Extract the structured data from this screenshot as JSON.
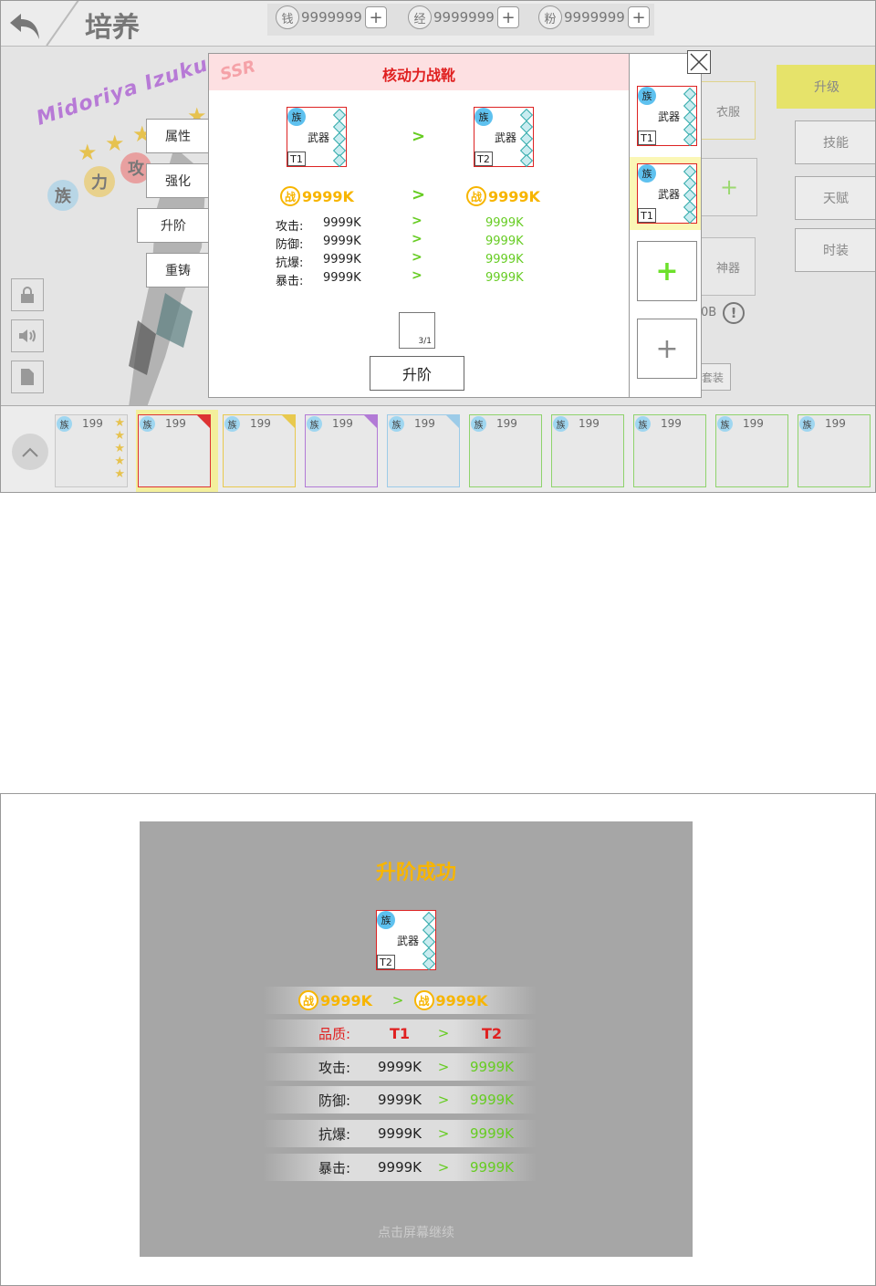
{
  "header": {
    "title": "培养",
    "currencies": [
      {
        "icon": "钱",
        "value": "9999999"
      },
      {
        "icon": "经",
        "value": "9999999"
      },
      {
        "icon": "粉",
        "value": "9999999"
      }
    ],
    "plus": "+"
  },
  "hero": {
    "name": "Midoriya Izuku",
    "badges": [
      "族",
      "力",
      "攻"
    ]
  },
  "menu": [
    "属性",
    "强化",
    "升阶",
    "重铸"
  ],
  "right_menu": [
    "升级",
    "技能",
    "天赋",
    "时装"
  ],
  "equip_slots": {
    "clothes": "衣服",
    "artifact": "神器",
    "plus": "+",
    "frag_text": "0B",
    "info_mark": "!",
    "equip_text": "套装"
  },
  "dialog": {
    "rarity": "SSR",
    "title": "核动力战靴",
    "from_card": {
      "zu": "族",
      "name": "武器",
      "tier": "T1"
    },
    "to_card": {
      "zu": "族",
      "name": "武器",
      "tier": "T2"
    },
    "arrow": ">",
    "power_icon": "战",
    "power_from": "9999K",
    "power_to": "9999K",
    "stats": [
      {
        "label": "攻击:",
        "from": "9999K",
        "to": "9999K"
      },
      {
        "label": "防御:",
        "from": "9999K",
        "to": "9999K"
      },
      {
        "label": "抗爆:",
        "from": "9999K",
        "to": "9999K"
      },
      {
        "label": "暴击:",
        "from": "9999K",
        "to": "9999K"
      }
    ],
    "material_count": "3/1",
    "upgrade_button": "升阶"
  },
  "side_cards": [
    {
      "zu": "族",
      "name": "武器",
      "tier": "T1"
    },
    {
      "zu": "族",
      "name": "武器",
      "tier": "T1"
    }
  ],
  "side_add": "+",
  "items": [
    {
      "zu": "族",
      "level": "199",
      "border": "#c8c8c8"
    },
    {
      "zu": "族",
      "level": "199",
      "border": "#d33"
    },
    {
      "zu": "族",
      "level": "199",
      "border": "#e8c94e"
    },
    {
      "zu": "族",
      "level": "199",
      "border": "#b27ad6"
    },
    {
      "zu": "族",
      "level": "199",
      "border": "#9ccbe8"
    },
    {
      "zu": "族",
      "level": "199",
      "border": "#8fd36c"
    },
    {
      "zu": "族",
      "level": "199",
      "border": "#8fd36c"
    },
    {
      "zu": "族",
      "level": "199",
      "border": "#8fd36c"
    },
    {
      "zu": "族",
      "level": "199",
      "border": "#8fd36c"
    },
    {
      "zu": "族",
      "level": "199",
      "border": "#8fd36c"
    }
  ],
  "result": {
    "title": "升阶成功",
    "card": {
      "zu": "族",
      "name": "武器",
      "tier": "T2"
    },
    "power_icon": "战",
    "power_from": "9999K",
    "power_to": "9999K",
    "quality": {
      "label": "品质:",
      "from": "T1",
      "to": "T2"
    },
    "stats": [
      {
        "label": "攻击:",
        "from": "9999K",
        "to": "9999K"
      },
      {
        "label": "防御:",
        "from": "9999K",
        "to": "9999K"
      },
      {
        "label": "抗爆:",
        "from": "9999K",
        "to": "9999K"
      },
      {
        "label": "暴击:",
        "from": "9999K",
        "to": "9999K"
      }
    ],
    "continue": "点击屏幕继续"
  }
}
